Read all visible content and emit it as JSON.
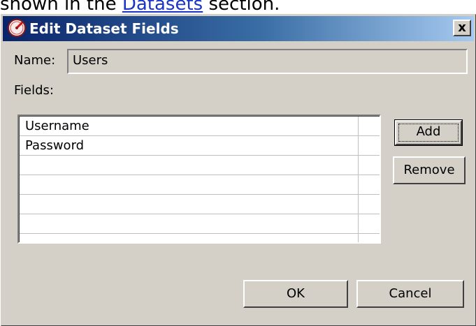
{
  "document": {
    "text_before_link": "shown in the ",
    "link_text": "Datasets",
    "text_after_link": " section."
  },
  "dialog": {
    "title": "Edit Dataset Fields",
    "close_label": "x",
    "name_label": "Name:",
    "name_value": "Users",
    "fields_label": "Fields:",
    "fields": [
      "Username",
      "Password",
      "",
      "",
      "",
      ""
    ],
    "add_label": "Add",
    "remove_label": "Remove",
    "ok_label": "OK",
    "cancel_label": "Cancel"
  },
  "colors": {
    "dialog_bg": "#d4d0c8",
    "titlebar_start": "#0a246a",
    "titlebar_end": "#a6caf0",
    "link": "#1a35c8"
  }
}
